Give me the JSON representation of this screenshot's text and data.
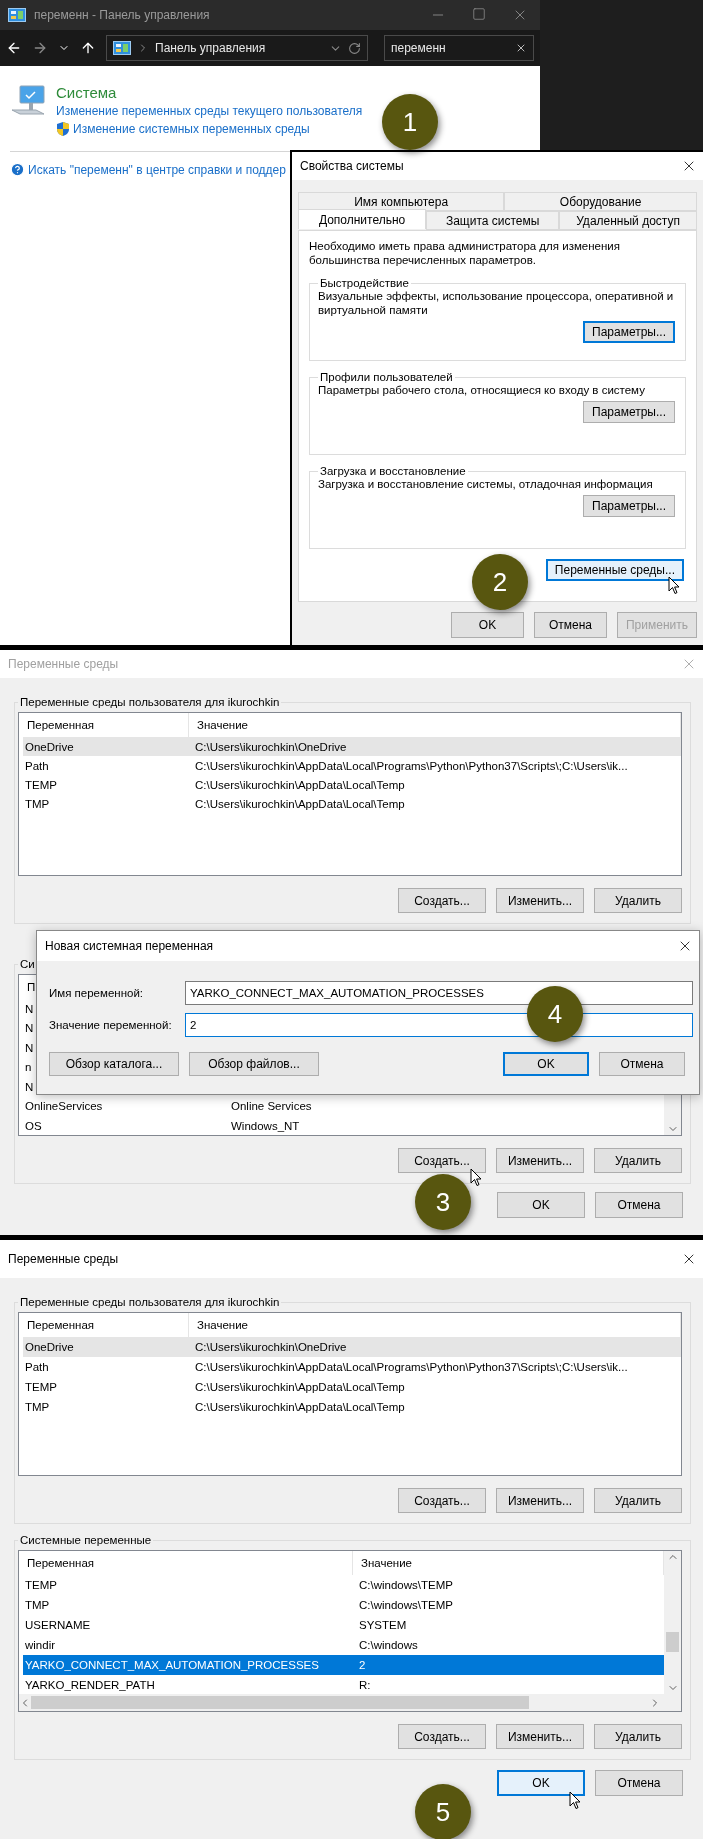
{
  "control_panel": {
    "title": "переменн - Панель управления",
    "address": "Панель управления",
    "search": "переменн",
    "step": "1",
    "result": {
      "title": "Система",
      "links": [
        "Изменение переменных среды текущего пользователя",
        "Изменение системных переменных среды"
      ]
    },
    "help_link": "Искать \"переменн\" в центре справки и поддер"
  },
  "system_properties": {
    "title": "Свойства системы",
    "step": "2",
    "tab_rows": [
      [
        {
          "label": "Имя компьютера",
          "selected": false
        },
        {
          "label": "Оборудование",
          "selected": false
        }
      ],
      [
        {
          "label": "Дополнительно",
          "selected": true
        },
        {
          "label": "Защита системы",
          "selected": false
        },
        {
          "label": "Удаленный доступ",
          "selected": false
        }
      ]
    ],
    "note": "Необходимо иметь права администратора для изменения большинства перечисленных параметров.",
    "groups": [
      {
        "title": "Быстродействие",
        "text": "Визуальные эффекты, использование процессора, оперативной и виртуальной памяти",
        "button": {
          "label": "Параметры...",
          "focused": true,
          "hovered": false,
          "pointer": false
        }
      },
      {
        "title": "Профили пользователей",
        "text": "Параметры рабочего стола, относящиеся ко входу в систему",
        "button": {
          "label": "Параметры...",
          "focused": false,
          "hovered": false,
          "pointer": false
        }
      },
      {
        "title": "Загрузка и восстановление",
        "text": "Загрузка и восстановление системы, отладочная информация",
        "button": {
          "label": "Параметры...",
          "focused": false,
          "hovered": false,
          "pointer": false
        }
      }
    ],
    "env_button": {
      "label": "Переменные среды...",
      "focused": true,
      "hovered": true,
      "pointer": true
    },
    "buttons": [
      {
        "label": "OK",
        "disabled": false
      },
      {
        "label": "Отмена",
        "disabled": false
      },
      {
        "label": "Применить",
        "disabled": true
      }
    ]
  },
  "env_step3": {
    "title": "Переменные среды",
    "active": false,
    "step": "3",
    "groups": [
      {
        "title": "Переменные среды пользователя для ikurochkin",
        "focused": false,
        "columns": [
          "Переменная",
          "Значение"
        ],
        "rows": [
          {
            "name": "OneDrive",
            "value": "C:\\Users\\ikurochkin\\OneDrive",
            "selected": true
          },
          {
            "name": "Path",
            "value": "C:\\Users\\ikurochkin\\AppData\\Local\\Programs\\Python\\Python37\\Scripts\\;C:\\Users\\ik...",
            "selected": false
          },
          {
            "name": "TEMP",
            "value": "C:\\Users\\ikurochkin\\AppData\\Local\\Temp",
            "selected": false
          },
          {
            "name": "TMP",
            "value": "C:\\Users\\ikurochkin\\AppData\\Local\\Temp",
            "selected": false
          }
        ],
        "buttons": [
          {
            "label": "Создать...",
            "pointer": false
          },
          {
            "label": "Изменить...",
            "pointer": false
          },
          {
            "label": "Удалить",
            "pointer": false
          }
        ]
      },
      {
        "title": "Си",
        "columns": [
          "П"
        ],
        "rows": [
          {
            "name": "N",
            "selected": false
          },
          {
            "name": "N",
            "selected": false
          },
          {
            "name": "N",
            "selected": false
          },
          {
            "name": "n",
            "selected": false
          },
          {
            "name": "N",
            "selected": false
          },
          {
            "name": "OnlineServices",
            "value": "Online Services",
            "selected": false
          },
          {
            "name": "OS",
            "value": "Windows_NT",
            "selected": false
          }
        ],
        "buttons": [
          {
            "label": "Создать...",
            "pointer": true
          },
          {
            "label": "Изменить...",
            "pointer": false
          },
          {
            "label": "Удалить",
            "pointer": false
          }
        ]
      }
    ],
    "buttons": [
      {
        "label": "OK",
        "focused": false,
        "hovered": false,
        "pointer": false
      },
      {
        "label": "Отмена",
        "focused": false,
        "hovered": false,
        "pointer": false
      }
    ],
    "new_variable": {
      "title": "Новая системная переменная",
      "step": "4",
      "fields": [
        {
          "label": "Имя переменной:",
          "value": "YARKO_CONNECT_MAX_AUTOMATION_PROCESSES",
          "focused": false
        },
        {
          "label": "Значение переменной:",
          "value": "2",
          "focused": true
        }
      ],
      "browse_buttons": [
        "Обзор каталога...",
        "Обзор файлов..."
      ],
      "buttons": [
        {
          "label": "OK",
          "focused": true
        },
        {
          "label": "Отмена",
          "focused": false
        }
      ]
    }
  },
  "env_step5": {
    "title": "Переменные среды",
    "active": true,
    "step": "5",
    "groups": [
      {
        "title": "Переменные среды пользователя для ikurochkin",
        "focused": false,
        "columns": [
          "Переменная",
          "Значение"
        ],
        "rows": [
          {
            "name": "OneDrive",
            "value": "C:\\Users\\ikurochkin\\OneDrive",
            "selected": true
          },
          {
            "name": "Path",
            "value": "C:\\Users\\ikurochkin\\AppData\\Local\\Programs\\Python\\Python37\\Scripts\\;C:\\Users\\ik...",
            "selected": false
          },
          {
            "name": "TEMP",
            "value": "C:\\Users\\ikurochkin\\AppData\\Local\\Temp",
            "selected": false
          },
          {
            "name": "TMP",
            "value": "C:\\Users\\ikurochkin\\AppData\\Local\\Temp",
            "selected": false
          }
        ],
        "buttons": [
          {
            "label": "Создать...",
            "pointer": false
          },
          {
            "label": "Изменить...",
            "pointer": false
          },
          {
            "label": "Удалить",
            "pointer": false
          }
        ]
      },
      {
        "title": "Системные переменные",
        "focused": true,
        "columns": [
          "Переменная",
          "Значение"
        ],
        "rows": [
          {
            "name": "TEMP",
            "value": "C:\\windows\\TEMP",
            "selected": false
          },
          {
            "name": "TMP",
            "value": "C:\\windows\\TEMP",
            "selected": false
          },
          {
            "name": "USERNAME",
            "value": "SYSTEM",
            "selected": false
          },
          {
            "name": "windir",
            "value": "C:\\windows",
            "selected": false
          },
          {
            "name": "YARKO_CONNECT_MAX_AUTOMATION_PROCESSES",
            "value": "2",
            "selected": true
          },
          {
            "name": "YARKO_RENDER_PATH",
            "value": "R:",
            "selected": false
          }
        ],
        "buttons": [
          {
            "label": "Создать...",
            "pointer": false
          },
          {
            "label": "Изменить...",
            "pointer": false
          },
          {
            "label": "Удалить",
            "pointer": false
          }
        ]
      }
    ],
    "buttons": [
      {
        "label": "OK",
        "focused": true,
        "hovered": true,
        "pointer": true
      },
      {
        "label": "Отмена",
        "focused": false,
        "hovered": false,
        "pointer": false
      }
    ]
  }
}
